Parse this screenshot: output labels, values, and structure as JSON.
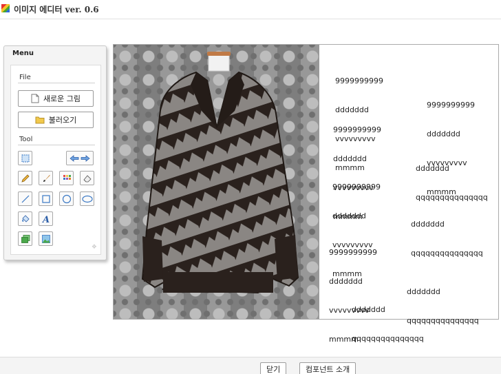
{
  "window": {
    "title": "이미지 에디터 ver. 0.6"
  },
  "menu": {
    "title": "Menu",
    "file_label": "File",
    "new_image": "새로운 그림",
    "open": "불러오기",
    "tool_label": "Tool"
  },
  "tools": [
    "select-icon",
    "undo-redo-arrows-icon",
    "pencil-icon",
    "brush-icon",
    "palette-icon",
    "eraser-icon",
    "line-icon",
    "rectangle-icon",
    "circle-icon",
    "ellipse-icon",
    "paint-bucket-icon",
    "text-icon",
    "layer-icon",
    "image-icon"
  ],
  "canvas": {
    "text_objects": [
      {
        "id": "t1",
        "lines": [
          "9999999999",
          "ddddddd",
          "vvvvvvvvv",
          "mmmm"
        ]
      },
      {
        "id": "t2",
        "lines": [
          "9999999999",
          "ddddddd",
          "vvvvvvvvv",
          "mmmm"
        ]
      },
      {
        "id": "t3",
        "lines": [
          "9999999999",
          "ddddddd",
          "vvvvvvvvv",
          "mmmm"
        ]
      },
      {
        "id": "t4",
        "lines": [
          "ddddddd",
          "qqqqqqqqqqqqqqq"
        ]
      },
      {
        "id": "t5",
        "lines": [
          "9999999999",
          "ddddddd",
          "vvvvvvvvv",
          "mmmm"
        ]
      },
      {
        "id": "t6",
        "lines": [
          "ddddddd",
          "qqqqqqqqqqqqqqq"
        ]
      },
      {
        "id": "t7",
        "lines": [
          "9999999999",
          "ddddddd",
          "vvvvvvvvv",
          "mmmm"
        ]
      },
      {
        "id": "t8",
        "lines": [
          "ddddddd",
          "qqqqqqqqqqqqqqq"
        ]
      },
      {
        "id": "t9",
        "lines": [
          "ddddddd",
          "qqqqqqqqqqqqqqq"
        ]
      }
    ]
  },
  "footer": {
    "close": "닫기",
    "component_intro": "컴포넌트 소개"
  }
}
